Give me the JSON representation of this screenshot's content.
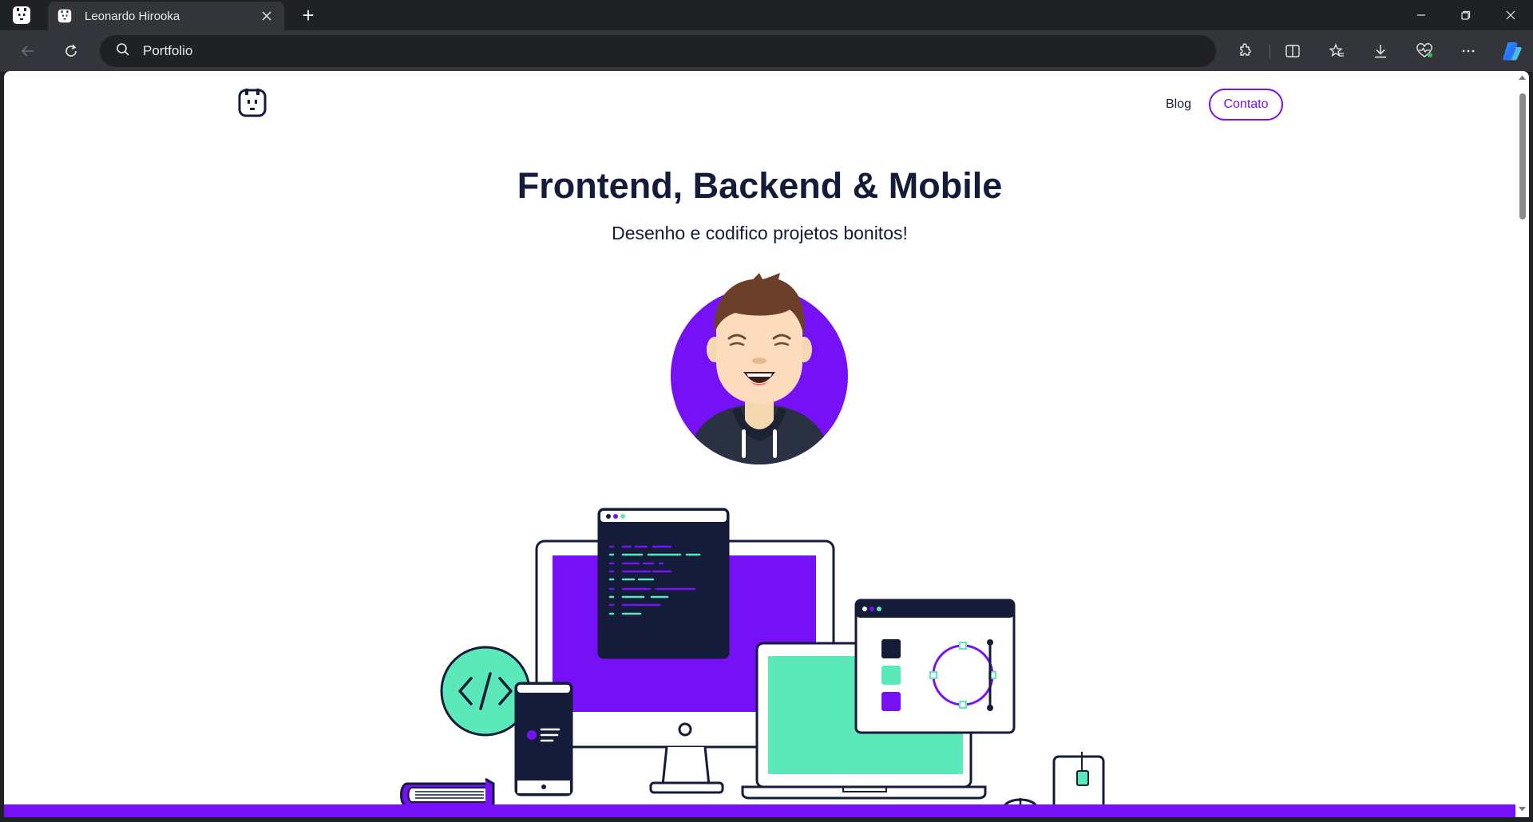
{
  "browser": {
    "tab": {
      "title": "Leonardo Hirooka"
    },
    "new_tab_label": "+",
    "address_bar": {
      "text": "Portfolio",
      "icon": "search-icon"
    },
    "toolbar_icons": [
      "extensions-icon",
      "split-screen-icon",
      "favorites-icon",
      "downloads-icon",
      "browser-essentials-icon",
      "more-icon",
      "copilot-icon"
    ],
    "window_controls": [
      "minimize-icon",
      "restore-icon",
      "close-icon"
    ]
  },
  "site": {
    "nav": {
      "blog": "Blog",
      "contact": "Contato"
    },
    "hero": {
      "title": "Frontend, Backend & Mobile",
      "subtitle": "Desenho e codifico projetos bonitos!"
    }
  },
  "colors": {
    "brand_purple": "#7510f7",
    "mint": "#5be9b9",
    "navy": "#141c3a",
    "chrome_dark": "#202124",
    "chrome_toolbar": "#34353a"
  }
}
